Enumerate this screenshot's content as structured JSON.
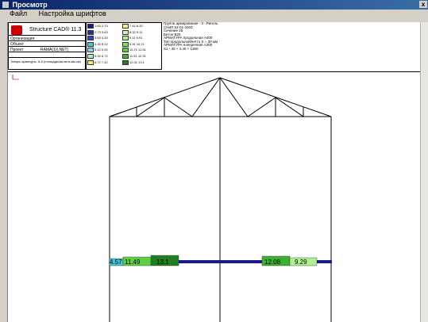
{
  "window": {
    "title": "Просмотр",
    "close_glyph": "x"
  },
  "menu": {
    "file": "Файл",
    "fonts": "Настройка шрифтов"
  },
  "stamp": {
    "brand": "Structure CAD® 11.3",
    "rows": [
      {
        "label": "Организация",
        "value": ""
      },
      {
        "label": "Объект",
        "value": ""
      },
      {
        "label": "Проект",
        "value": "RAMA(1)(.NET)"
      }
    ],
    "note": "Эпюры арматуры. А-II (площадь/нм.кв.м.мм.см)"
  },
  "legend": {
    "items": [
      {
        "range": "1.83   2.73",
        "color": "#1a1a8c"
      },
      {
        "range": "2.73   3.63",
        "color": "#2d2db0"
      },
      {
        "range": "3.63   4.33",
        "color": "#3a3ad0"
      },
      {
        "range": "4.33   5.12",
        "color": "#46c8d8"
      },
      {
        "range": "5.12   5.92",
        "color": "#7fe0e0"
      },
      {
        "range": "5.92   6.72",
        "color": "#b0f0c8"
      },
      {
        "range": "6.72   7.42",
        "color": "#f0f060"
      },
      {
        "range": "7.42   8.32",
        "color": "#f0f080"
      },
      {
        "range": "8.32   9.11",
        "color": "#d0f0a0"
      },
      {
        "range": "9.11   9.91",
        "color": "#b0f090"
      },
      {
        "range": "9.91   10.71",
        "color": "#80e060"
      },
      {
        "range": "10.71  11.51",
        "color": "#60d040"
      },
      {
        "range": "11.51  12.31",
        "color": "#40b030"
      },
      {
        "range": "12.31  13.1",
        "color": "#208020"
      }
    ]
  },
  "info": {
    "lines": [
      "Группа армирования - 3 - Ригель",
      "СНиП 52-01-2003",
      "Сечение 25",
      "Бетон В25",
      "АРМАТУРА продольная A400",
      "Тип продольной/нетто S = 30 мм",
      "АРМАТУРА поперечная A300",
      "S1 - 40 + 4.40 + 1350"
    ]
  },
  "drawing": {
    "bar_labels": [
      "4.57",
      "11.49",
      "13.1",
      "12.08",
      "9.29"
    ]
  },
  "colors": {
    "beam": "#1a1a8c",
    "accent_title": "#0a246a"
  }
}
